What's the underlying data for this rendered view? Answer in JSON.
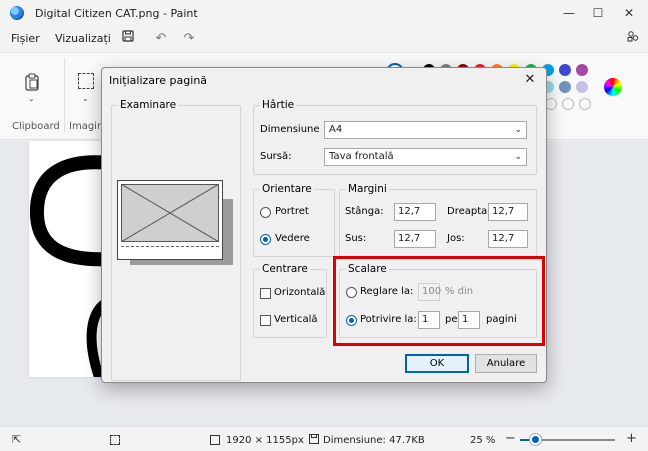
{
  "window": {
    "title": "Digital Citizen CAT.png - Paint",
    "minimize": "—",
    "maximize": "☐",
    "close": "✕"
  },
  "menu": {
    "file": "Fișier",
    "view": "Vizualizați"
  },
  "ribbon": {
    "clipboard": "Clipboard",
    "image": "Imagine"
  },
  "palette": {
    "row1": [
      "#000000",
      "#7f7f7f",
      "#880015",
      "#ed1c24",
      "#ff7f27",
      "#fff200",
      "#22b14c",
      "#00a2e8",
      "#3f48cc",
      "#a349a4"
    ],
    "row2": [
      "#ffffff",
      "#c3c3c3",
      "#b97a57",
      "#ffaec9",
      "#ffc90e",
      "#efe4b0",
      "#b5e61d",
      "#99d9ea",
      "#7092be",
      "#c8bfe7"
    ]
  },
  "status": {
    "size": "1920 × 1155px",
    "file_size": "Dimensiune: 47.7KB",
    "zoom": "25 %",
    "zoom_level": 0.25
  },
  "dialog": {
    "title": "Inițializare pagină",
    "preview_group": "Examinare",
    "paper": {
      "group": "Hârtie",
      "size_label": "Dimensiune",
      "size_value": "A4",
      "source_label": "Sursă:",
      "source_value": "Tava frontală"
    },
    "orientation": {
      "group": "Orientare",
      "portrait": "Portret",
      "landscape": "Vedere"
    },
    "margins": {
      "group": "Margini",
      "left_label": "Stânga:",
      "left_value": "12,7",
      "right_label": "Dreapta:",
      "right_value": "12,7",
      "top_label": "Sus:",
      "top_value": "12,7",
      "bottom_label": "Jos:",
      "bottom_value": "12,7"
    },
    "centering": {
      "group": "Centrare",
      "horizontal": "Orizontală",
      "vertical": "Verticală"
    },
    "scaling": {
      "group": "Scalare",
      "adjust_label": "Reglare la:",
      "adjust_value": "100",
      "adjust_unit": "% din",
      "fit_label": "Potrivire la:",
      "fit_pages_wide": "1",
      "fit_by": "pe",
      "fit_pages_tall": "1",
      "fit_unit": "pagini"
    },
    "ok": "OK",
    "cancel": "Anulare"
  }
}
